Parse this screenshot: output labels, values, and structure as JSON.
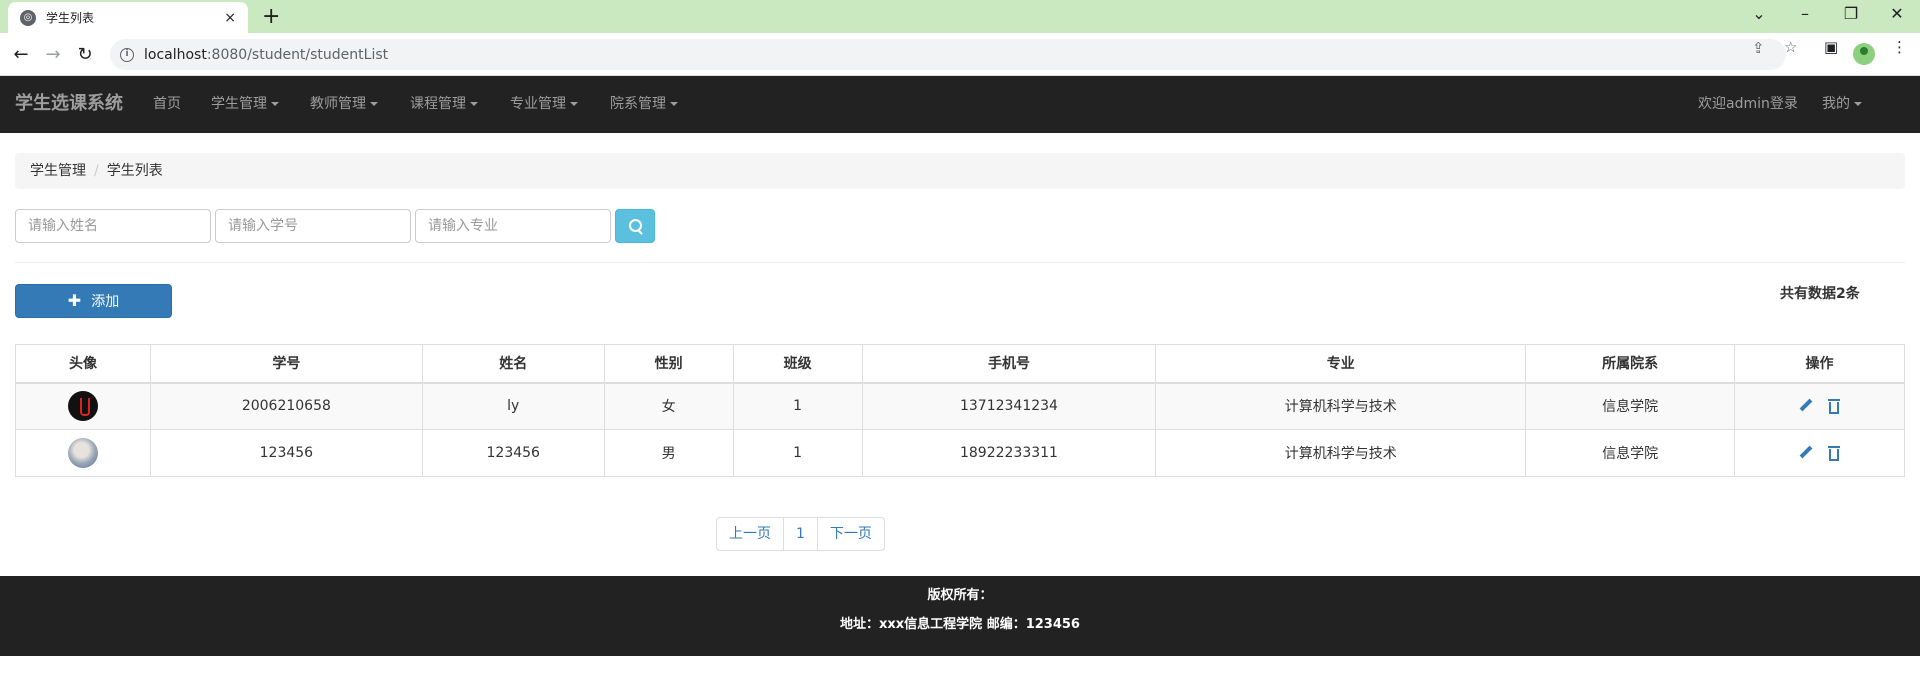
{
  "browser": {
    "tab_title": "学生列表",
    "tab_close": "×",
    "new_tab": "+",
    "url_host": "localhost",
    "url_path": ":8080/student/studentList",
    "icons": [
      "globe-icon",
      "back-icon",
      "forward-icon",
      "reload-icon",
      "info-icon",
      "share-icon",
      "star-icon",
      "sidepanel-icon",
      "profile-icon",
      "menu-icon"
    ]
  },
  "navbar": {
    "brand": "学生选课系统",
    "items": [
      {
        "label": "首页",
        "dropdown": false
      },
      {
        "label": "学生管理",
        "dropdown": true
      },
      {
        "label": "教师管理",
        "dropdown": true
      },
      {
        "label": "课程管理",
        "dropdown": true
      },
      {
        "label": "专业管理",
        "dropdown": true
      },
      {
        "label": "院系管理",
        "dropdown": true
      }
    ],
    "welcome": "欢迎admin登录",
    "mine": "我的"
  },
  "breadcrumb": [
    "学生管理",
    "学生列表"
  ],
  "search": {
    "name_placeholder": "请输入姓名",
    "id_placeholder": "请输入学号",
    "major_placeholder": "请输入专业"
  },
  "add_label": "添加",
  "count_text": "共有数据2条",
  "table": {
    "headers": [
      "头像",
      "学号",
      "姓名",
      "性别",
      "班级",
      "手机号",
      "专业",
      "所属院系",
      "操作"
    ],
    "rows": [
      {
        "id": "2006210658",
        "name": "ly",
        "gender": "女",
        "class": "1",
        "phone": "13712341234",
        "major": "计算机科学与技术",
        "dept": "信息学院"
      },
      {
        "id": "123456",
        "name": "123456",
        "gender": "男",
        "class": "1",
        "phone": "18922233311",
        "major": "计算机科学与技术",
        "dept": "信息学院"
      }
    ]
  },
  "pagination": {
    "prev": "上一页",
    "page": "1",
    "next": "下一页"
  },
  "footer": {
    "line1": "版权所有：",
    "line2": "地址：xxx信息工程学院 邮编：123456"
  },
  "colors": {
    "navbar_bg": "#222222",
    "primary": "#337ab7",
    "info": "#5bc0de",
    "tabstrip": "#cbe9c0"
  }
}
